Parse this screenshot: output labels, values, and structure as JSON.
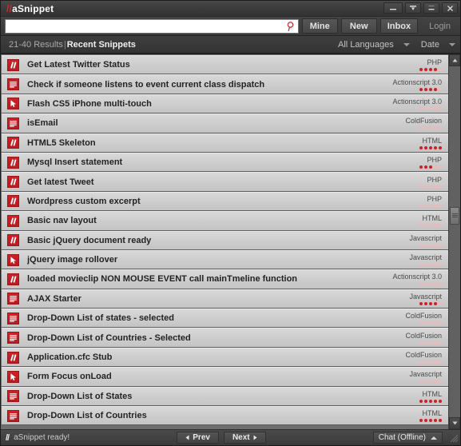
{
  "window": {
    "title_prefix": "//",
    "title": "aSnippet",
    "controls": [
      {
        "name": "minimize",
        "glyph": "minimize"
      },
      {
        "name": "collapse",
        "glyph": "collapse"
      },
      {
        "name": "restore",
        "glyph": "restore"
      },
      {
        "name": "close",
        "glyph": "close"
      }
    ]
  },
  "toolbar": {
    "search_value": "",
    "search_placeholder": "",
    "search_icon": "search-icon",
    "buttons": [
      {
        "label": "Mine",
        "name": "mine"
      },
      {
        "label": "New",
        "name": "new"
      },
      {
        "label": "Inbox",
        "name": "inbox"
      }
    ],
    "login_label": "Login"
  },
  "filterbar": {
    "results_count": "21-40 Results",
    "separator": "|",
    "view_label": "Recent Snippets",
    "language_filter": "All Languages",
    "sort_filter": "Date"
  },
  "list": {
    "rows": [
      {
        "icon": "code-comment-icon",
        "title": "Get Latest Twitter Status",
        "language": "PHP",
        "rating": 4
      },
      {
        "icon": "document-lines-icon",
        "title": "Check if someone listens to event current class dispatch",
        "language": "Actionscript 3.0",
        "rating": 4
      },
      {
        "icon": "cursor-arrow-icon",
        "title": "Flash CS5 iPhone multi-touch",
        "language": "Actionscript 3.0",
        "rating": 0
      },
      {
        "icon": "document-lines-icon",
        "title": "isEmail",
        "language": "ColdFusion",
        "rating": 0
      },
      {
        "icon": "code-comment-icon",
        "title": "HTML5 Skeleton",
        "language": "HTML",
        "rating": 5
      },
      {
        "icon": "code-comment-icon",
        "title": "Mysql Insert statement",
        "language": "PHP",
        "rating": 3
      },
      {
        "icon": "code-comment-icon",
        "title": "Get latest Tweet",
        "language": "PHP",
        "rating": 0
      },
      {
        "icon": "code-comment-icon",
        "title": "Wordpress custom excerpt",
        "language": "PHP",
        "rating": 0
      },
      {
        "icon": "code-comment-icon",
        "title": "Basic nav layout",
        "language": "HTML",
        "rating": 0
      },
      {
        "icon": "code-comment-icon",
        "title": "Basic jQuery document ready",
        "language": "Javascript",
        "rating": 0
      },
      {
        "icon": "cursor-arrow-icon",
        "title": "jQuery image rollover",
        "language": "Javascript",
        "rating": 0
      },
      {
        "icon": "code-comment-icon",
        "title": "loaded movieclip NON MOUSE EVENT call mainTmeline function",
        "language": "Actionscript 3.0",
        "rating": 0
      },
      {
        "icon": "document-lines-icon",
        "title": "AJAX Starter",
        "language": "Javascript",
        "rating": 4
      },
      {
        "icon": "document-lines-icon",
        "title": "Drop-Down List of states - selected",
        "language": "ColdFusion",
        "rating": 0
      },
      {
        "icon": "document-lines-icon",
        "title": "Drop-Down List of Countries - Selected",
        "language": "ColdFusion",
        "rating": 0
      },
      {
        "icon": "code-comment-icon",
        "title": "Application.cfc Stub",
        "language": "ColdFusion",
        "rating": 0
      },
      {
        "icon": "cursor-arrow-icon",
        "title": "Form Focus onLoad",
        "language": "Javascript",
        "rating": 0
      },
      {
        "icon": "document-lines-icon",
        "title": "Drop-Down List of States",
        "language": "HTML",
        "rating": 5
      },
      {
        "icon": "document-lines-icon",
        "title": "Drop-Down List of Countries",
        "language": "HTML",
        "rating": 5
      }
    ],
    "rating_max": 5
  },
  "statusbar": {
    "logo": "//",
    "message": "aSnippet ready!",
    "prev_label": "Prev",
    "next_label": "Next",
    "chat_label": "Chat (Offline)"
  },
  "colors": {
    "accent_red": "#cf1f26",
    "chrome_dark": "#3b3b3b",
    "row_light": "#d4d4d4",
    "rating_empty": "#edb9bb"
  }
}
